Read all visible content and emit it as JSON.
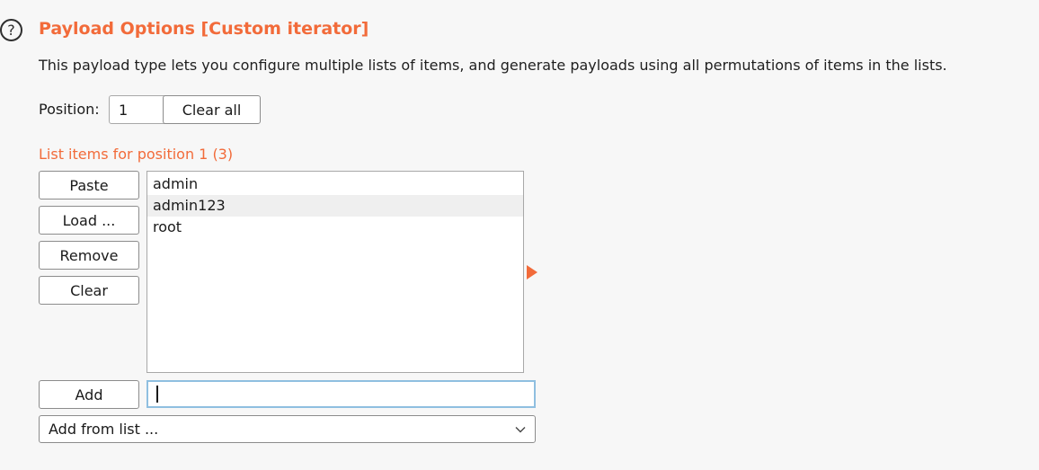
{
  "header": {
    "help_icon_glyph": "?",
    "title": "Payload Options [Custom iterator]",
    "accent_color": "#f26b3a"
  },
  "description": "This payload type lets you configure multiple lists of items, and generate payloads using all permutations of items in the lists.",
  "position": {
    "label": "Position:",
    "value": "1",
    "clear_all_label": "Clear all"
  },
  "list": {
    "header": "List items for position 1 (3)",
    "items": [
      "admin",
      "admin123",
      "root"
    ],
    "buttons": {
      "paste": "Paste",
      "load": "Load ...",
      "remove": "Remove",
      "clear": "Clear",
      "add": "Add"
    },
    "add_input_value": "",
    "add_from_list_label": "Add from list ..."
  }
}
